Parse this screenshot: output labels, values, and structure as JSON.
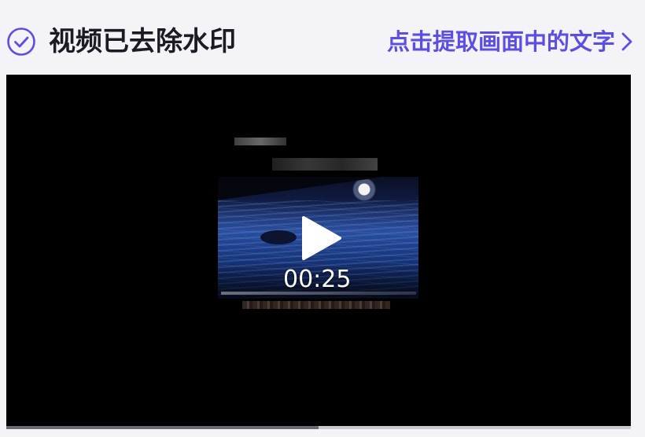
{
  "header": {
    "status_text": "视频已去除水印",
    "extract_link_label": "点击提取画面中的文字",
    "check_icon": "check-circle-icon",
    "chevron_icon": "chevron-right-icon"
  },
  "player": {
    "duration": "00:25",
    "play_icon": "play-icon",
    "playback_progress": 0.5
  },
  "colors": {
    "accent": "#5b4ee6",
    "background": "#f3f3f8",
    "player_background": "#000000",
    "title_text": "#1b1b22"
  }
}
